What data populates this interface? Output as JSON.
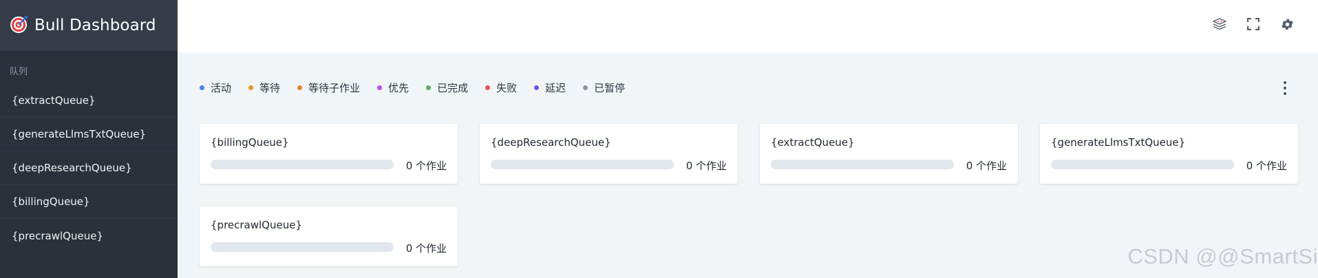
{
  "app": {
    "title": "Bull Dashboard"
  },
  "sidebar": {
    "section_label": "队列",
    "queues": [
      "{extractQueue}",
      "{generateLlmsTxtQueue}",
      "{deepResearchQueue}",
      "{billingQueue}",
      "{precrawlQueue}"
    ]
  },
  "header": {
    "icons": [
      "redis-stack-icon",
      "fullscreen-icon",
      "settings-gear-icon"
    ]
  },
  "statuses": [
    {
      "label": "活动",
      "color": "#4a7ff2"
    },
    {
      "label": "等待",
      "color": "#e0991f"
    },
    {
      "label": "等待子作业",
      "color": "#e0852a"
    },
    {
      "label": "优先",
      "color": "#b94ef0"
    },
    {
      "label": "已完成",
      "color": "#55b05a"
    },
    {
      "label": "失败",
      "color": "#e05a57"
    },
    {
      "label": "延迟",
      "color": "#6b55e8"
    },
    {
      "label": "已暂停",
      "color": "#8f949b"
    }
  ],
  "cards": [
    {
      "name": "{billingQueue}",
      "count": "0 个作业"
    },
    {
      "name": "{deepResearchQueue}",
      "count": "0 个作业"
    },
    {
      "name": "{extractQueue}",
      "count": "0 个作业"
    },
    {
      "name": "{generateLlmsTxtQueue}",
      "count": "0 个作业"
    },
    {
      "name": "{precrawlQueue}",
      "count": "0 个作业"
    }
  ],
  "watermark": "CSDN @@SmartSi"
}
